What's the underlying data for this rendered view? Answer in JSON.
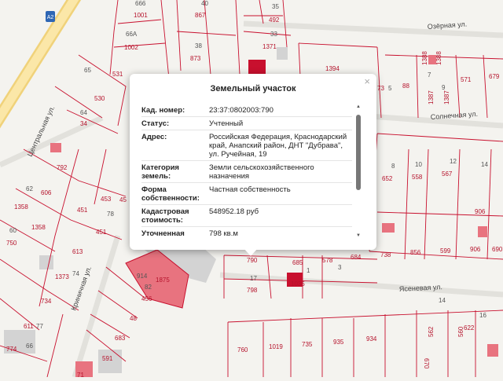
{
  "map": {
    "road_marker": "A2",
    "streets": {
      "ozernaya": "Озёрная ул.",
      "solnechnaya": "Солнечная ул.",
      "centralnaya": "Центральная ул.",
      "krinichnaya": "Криничная ул.",
      "yasenevaya": "Ясеневая ул."
    },
    "parcel_numbers": {
      "p666": "666",
      "p1001": "1001",
      "p40": "40",
      "p867": "867",
      "p35": "35",
      "p492": "492",
      "p66a": "66А",
      "p1002": "1002",
      "p38": "38",
      "p873": "873",
      "p33": "33",
      "p1371": "1371",
      "p65": "65",
      "p531": "531",
      "p1394": "1394",
      "p1388a": "1388",
      "p1388b": "1388",
      "p571": "571",
      "p679": "679",
      "p530": "530",
      "p64": "64",
      "p34": "34",
      "p73": "73",
      "p5": "5",
      "p88": "88",
      "p7": "7",
      "p9": "9",
      "p1387a": "1387",
      "p1387b": "1387",
      "p792": "792",
      "p62": "62",
      "p606": "606",
      "p453": "453",
      "p8": "8",
      "p652": "652",
      "p10": "10",
      "p558": "558",
      "p12": "12",
      "p567": "567",
      "p14": "14",
      "p1358a": "1358",
      "p451a": "451",
      "p78": "78",
      "p45": "45",
      "p1358b": "1358",
      "p906": "906",
      "p60": "60",
      "p750": "750",
      "p613": "613",
      "p451b": "451",
      "p738": "738",
      "p856": "856",
      "p599": "599",
      "p906b": "906",
      "p690": "690",
      "p578": "578",
      "p684": "684",
      "p685": "685",
      "p790": "790",
      "p1373": "1373",
      "p74": "74",
      "p914": "914",
      "p1875": "1875",
      "p17": "17",
      "p1035": "1035",
      "p734": "734",
      "p82": "82",
      "p456": "456",
      "p798": "798",
      "p48": "48",
      "p14b": "14",
      "p611": "611",
      "p77": "77",
      "p683": "683",
      "p774": "774",
      "p66": "66",
      "p591": "591",
      "p760": "760",
      "p1019": "1019",
      "p735": "735",
      "p935": "935",
      "p934": "934",
      "p562": "562",
      "p560": "560",
      "p622": "622",
      "p16": "16",
      "p670": "670",
      "p1": "1",
      "p3": "3",
      "p71": "71"
    }
  },
  "popup": {
    "title": "Земельный участок",
    "close_glyph": "×",
    "rows": [
      {
        "key": "Кад. номер:",
        "value": "23:37:0802003:790"
      },
      {
        "key": "Статус:",
        "value": "Учтенный"
      },
      {
        "key": "Адрес:",
        "value": "Российская Федерация, Краснодарский край, Анапский район, ДНТ \"Дубрава\", ул. Ручейная, 19"
      },
      {
        "key": "Категория земель:",
        "value": "Земли сельскохозяйственного назначения"
      },
      {
        "key": "Форма собственности:",
        "value": "Частная собственность"
      },
      {
        "key": "Кадастровая стоимость:",
        "value": "548952.18 руб"
      },
      {
        "key": "Уточненная площадь:",
        "value": "798 кв.м"
      }
    ]
  },
  "colors": {
    "boundary": "#c8102e",
    "highlight": "#e8737f",
    "building": "#cfcfcf",
    "road_major": "#f5c242"
  },
  "icons": {
    "close": "close-icon",
    "scroll_up": "scroll-up-icon",
    "scroll_down": "scroll-down-icon"
  }
}
